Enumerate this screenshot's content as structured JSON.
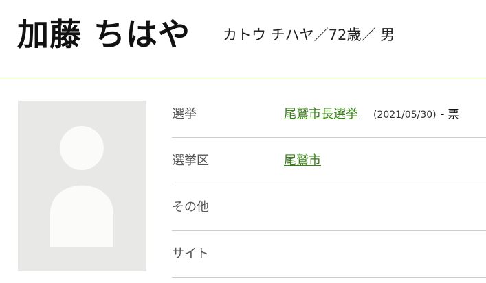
{
  "profile": {
    "name": "加藤 ちはや",
    "meta": "カトウ チハヤ／72歳／ 男"
  },
  "info": {
    "rows": [
      {
        "label": "選挙",
        "link": "尾鷲市長選挙",
        "date": "(2021/05/30)",
        "votes": "- 票"
      },
      {
        "label": "選挙区",
        "link": "尾鷲市"
      },
      {
        "label": "その他"
      },
      {
        "label": "サイト"
      }
    ]
  },
  "colors": {
    "accent_line": "#8bc34a",
    "link": "#3a7d1a",
    "photo_bg": "#e8e8e6"
  }
}
